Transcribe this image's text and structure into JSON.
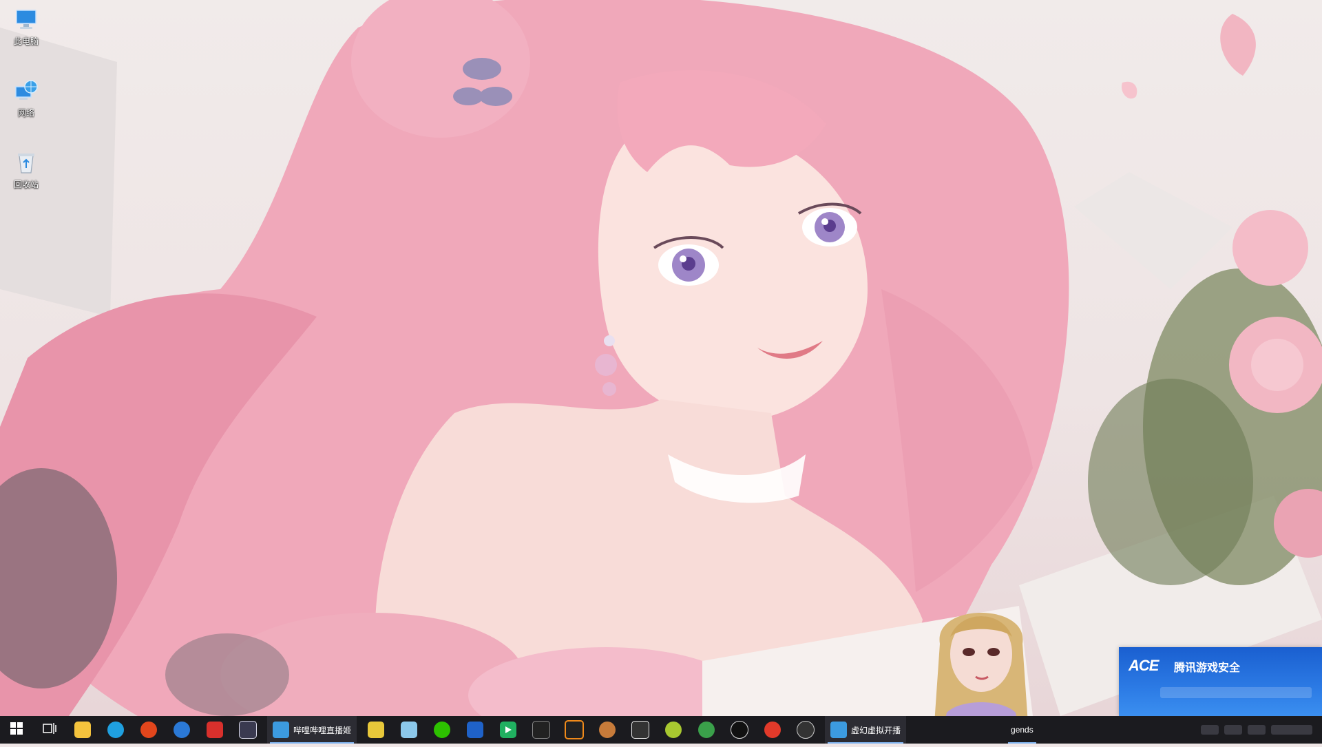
{
  "desktop": {
    "icons": [
      {
        "label": "此电脑",
        "icon": "this-pc-icon"
      },
      {
        "label": "网络",
        "icon": "network-icon"
      },
      {
        "label": "回收站",
        "icon": "recycle-bin-icon"
      }
    ]
  },
  "notification": {
    "logo": "ACE",
    "title": "腾讯游戏安全"
  },
  "taskbar": {
    "items": [
      {
        "icon": "windows-start-icon"
      },
      {
        "icon": "task-view-icon"
      },
      {
        "icon": "file-explorer-icon",
        "color": "#f4c33d"
      },
      {
        "icon": "edge-browser-icon",
        "color": "#1fa0e0"
      },
      {
        "icon": "ea-app-icon",
        "color": "#e2461c"
      },
      {
        "icon": "penguin-app-icon",
        "color": "#2b79d6"
      },
      {
        "icon": "red-app-icon",
        "color": "#d8302c"
      },
      {
        "icon": "controller-app-icon",
        "color": "#d8d8e8"
      },
      {
        "icon": "bilibili-live-icon",
        "label": "哔哩哔哩直播姬",
        "color": "#3c9be0"
      },
      {
        "icon": "yellow-app-icon",
        "color": "#e8c83a"
      },
      {
        "icon": "cat-app-icon",
        "color": "#8cc8ea"
      },
      {
        "icon": "wechat-icon",
        "color": "#2dc100"
      },
      {
        "icon": "pen-app-icon",
        "color": "#1f62c8"
      },
      {
        "icon": "play-app-icon",
        "color": "#20b060"
      },
      {
        "icon": "notebook-app-icon",
        "color": "#222"
      },
      {
        "icon": "orange-g-icon",
        "color": "#f08a1a"
      },
      {
        "icon": "monkey-app-icon",
        "color": "#c77b3a"
      },
      {
        "icon": "book-app-icon",
        "color": "#eeeeee"
      },
      {
        "icon": "green-ball-icon",
        "color": "#a8c830"
      },
      {
        "icon": "green-leaf-icon",
        "color": "#3aa04a"
      },
      {
        "icon": "qq-icon",
        "color": "#111"
      },
      {
        "icon": "red-circle-icon",
        "color": "#e23a2a"
      },
      {
        "icon": "globe-app-icon",
        "color": "#ccc"
      },
      {
        "icon": "vm-app-icon",
        "label": "虚幻虚拟开播",
        "color": "#3c9be0"
      },
      {
        "label": "gends"
      }
    ]
  }
}
